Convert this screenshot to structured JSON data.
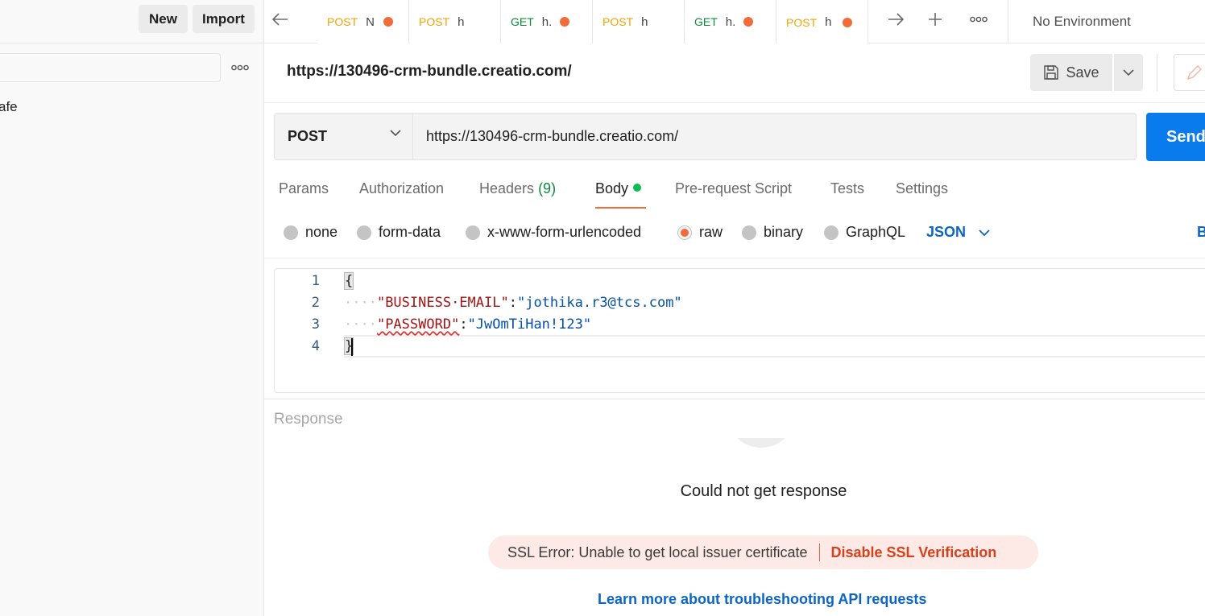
{
  "sidebar": {
    "new_label": "New",
    "import_label": "Import",
    "items": [
      {
        "label": "afe"
      }
    ]
  },
  "tabs": [
    {
      "method": "POST",
      "title": "N",
      "unsaved": true
    },
    {
      "method": "POST",
      "title": "h",
      "unsaved": false
    },
    {
      "method": "GET",
      "title": "h.",
      "unsaved": true
    },
    {
      "method": "POST",
      "title": "h",
      "unsaved": false
    },
    {
      "method": "GET",
      "title": "h.",
      "unsaved": true
    },
    {
      "method": "POST",
      "title": "h",
      "unsaved": true,
      "active": true
    }
  ],
  "environment": {
    "label": "No Environment"
  },
  "request": {
    "title": "https://130496-crm-bundle.creatio.com/",
    "save_label": "Save",
    "method": "POST",
    "url": "https://130496-crm-bundle.creatio.com/",
    "send_label": "Send"
  },
  "request_tabs": {
    "params": "Params",
    "authorization": "Authorization",
    "headers": "Headers",
    "headers_count": "(9)",
    "body": "Body",
    "prerequest": "Pre-request Script",
    "tests": "Tests",
    "settings": "Settings"
  },
  "body_types": {
    "none": "none",
    "form_data": "form-data",
    "urlencoded": "x-www-form-urlencoded",
    "raw": "raw",
    "binary": "binary",
    "graphql": "GraphQL",
    "selected": "raw",
    "language": "JSON",
    "beautify": "Beautify"
  },
  "editor": {
    "line_numbers": [
      "1",
      "2",
      "3",
      "4"
    ],
    "open_brace": "{",
    "close_brace": "}",
    "indent": "····",
    "line2_key": "\"BUSINESS·EMAIL\"",
    "line2_val": "\"jothika.r3@tcs.com\"",
    "line3_key": "\"PASSWORD\"",
    "line3_val": "\"JwOmTiHan!123\"",
    "colon": ":"
  },
  "response": {
    "label": "Response",
    "message": "Could not get response",
    "ssl_error": "SSL Error: Unable to get local issuer certificate",
    "disable_ssl": "Disable SSL Verification",
    "learn_more": "Learn more about troubleshooting API requests"
  },
  "colors": {
    "accent_orange": "#f26b3a",
    "send_blue": "#097bed",
    "link_blue": "#0b66c3",
    "post_color": "#f0a400",
    "get_color": "#0b8a3a"
  },
  "icons": {
    "back": "arrow-left-icon",
    "forward": "arrow-right-icon",
    "new_tab": "plus-icon",
    "more": "more-horizontal-icon",
    "save": "floppy-disk-icon",
    "edit": "pencil-icon"
  }
}
